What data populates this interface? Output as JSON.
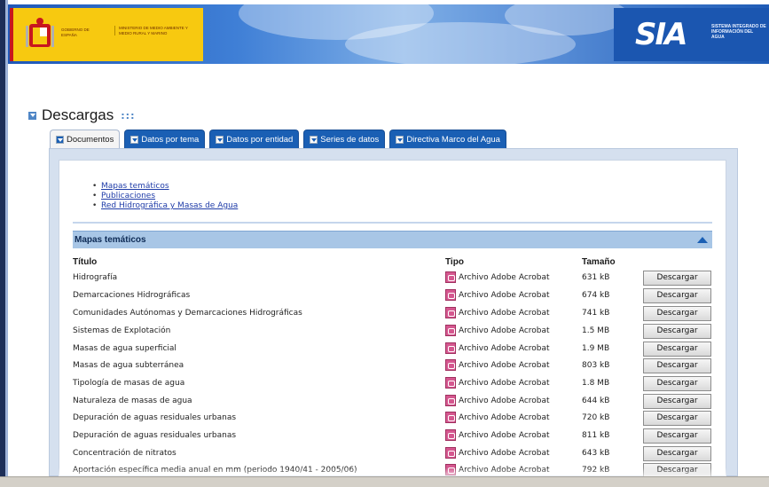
{
  "header": {
    "gov_name": "GOBIERNO DE ESPAÑA",
    "ministry": "MINISTERIO DE MEDIO AMBIENTE Y MEDIO RURAL Y MARINO",
    "sia_logo": "SIA",
    "sia_subtitle": "SISTEMA INTEGRADO DE INFORMACIÓN DEL AGUA"
  },
  "page": {
    "title": "Descargas",
    "title_extra": ":::"
  },
  "tabs": [
    {
      "label": "Documentos",
      "active": true
    },
    {
      "label": "Datos por tema",
      "active": false
    },
    {
      "label": "Datos por entidad",
      "active": false
    },
    {
      "label": "Series de datos",
      "active": false
    },
    {
      "label": "Directiva Marco del Agua",
      "active": false
    }
  ],
  "links": [
    "Mapas temáticos",
    "Publicaciones",
    "Red Hidrográfica y Masas de Agua"
  ],
  "section": {
    "title": "Mapas temáticos"
  },
  "table": {
    "headers": {
      "title": "Título",
      "type": "Tipo",
      "size": "Tamaño"
    },
    "button_label": "Descargar",
    "rows": [
      {
        "title": "Hidrografía",
        "type": "Archivo Adobe Acrobat",
        "size": "631 kB"
      },
      {
        "title": "Demarcaciones Hidrográficas",
        "type": "Archivo Adobe Acrobat",
        "size": "674 kB"
      },
      {
        "title": "Comunidades Autónomas y Demarcaciones Hidrográficas",
        "type": "Archivo Adobe Acrobat",
        "size": "741 kB"
      },
      {
        "title": "Sistemas de Explotación",
        "type": "Archivo Adobe Acrobat",
        "size": "1.5 MB"
      },
      {
        "title": "Masas de agua superficial",
        "type": "Archivo Adobe Acrobat",
        "size": "1.9 MB"
      },
      {
        "title": "Masas de agua subterránea",
        "type": "Archivo Adobe Acrobat",
        "size": "803 kB"
      },
      {
        "title": "Tipología de masas de agua",
        "type": "Archivo Adobe Acrobat",
        "size": "1.8 MB"
      },
      {
        "title": "Naturaleza de masas de agua",
        "type": "Archivo Adobe Acrobat",
        "size": "644 kB"
      },
      {
        "title": "Depuración de aguas residuales urbanas",
        "type": "Archivo Adobe Acrobat",
        "size": "720 kB"
      },
      {
        "title": "Depuración de aguas residuales urbanas",
        "type": "Archivo Adobe Acrobat",
        "size": "811 kB"
      },
      {
        "title": "Concentración de nitratos",
        "type": "Archivo Adobe Acrobat",
        "size": "643 kB"
      },
      {
        "title": "Aportación específica media anual en mm (periodo 1940/41 - 2005/06)",
        "type": "Archivo Adobe Acrobat",
        "size": "792 kB"
      }
    ]
  },
  "colors": {
    "accent": "#1a5fb4",
    "section_bar": "#a8c6e6",
    "gov_yellow": "#f7c910"
  }
}
